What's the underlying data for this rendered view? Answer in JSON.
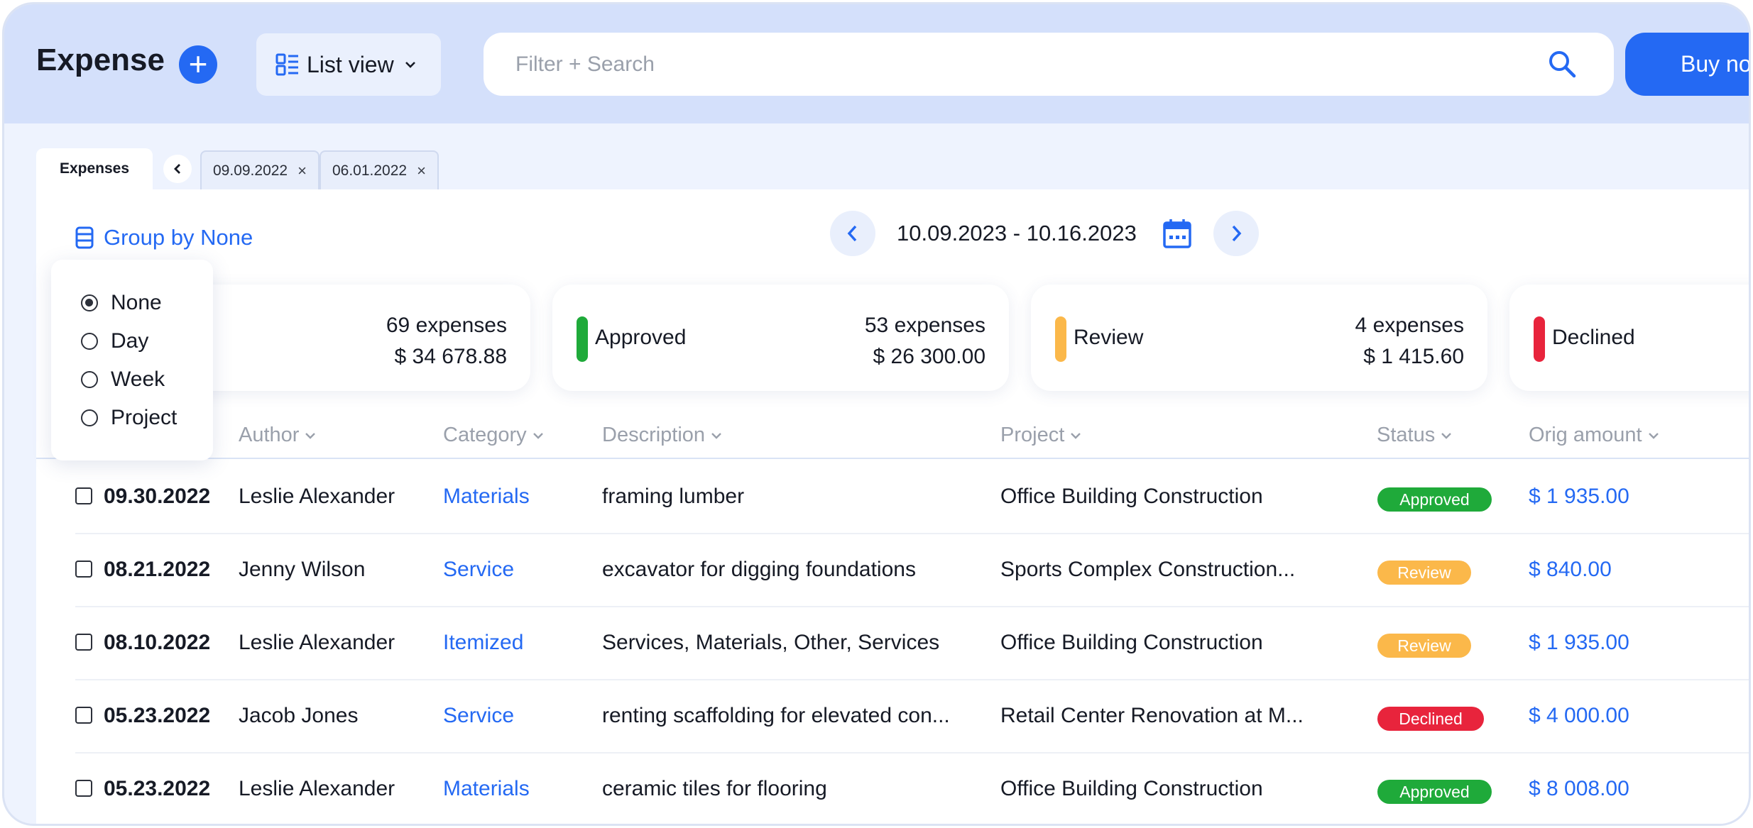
{
  "header": {
    "title": "Expense",
    "add_icon": "plus-circle-icon",
    "view_label": "List view",
    "search_placeholder": "Filter + Search",
    "buy_label": "Buy no"
  },
  "tabs": {
    "main": "Expenses",
    "chips": [
      {
        "label": "09.09.2022"
      },
      {
        "label": "06.01.2022"
      }
    ]
  },
  "toolbar": {
    "group_by_label": "Group by None",
    "date_range": "10.09.2023 - 10.16.2023"
  },
  "group_options": [
    {
      "label": "None",
      "selected": true
    },
    {
      "label": "Day",
      "selected": false
    },
    {
      "label": "Week",
      "selected": false
    },
    {
      "label": "Project",
      "selected": false
    }
  ],
  "summary_cards": [
    {
      "name": "",
      "count": "69 expenses",
      "amount": "$ 34 678.88",
      "color": ""
    },
    {
      "name": "Approved",
      "count": "53 expenses",
      "amount": "$ 26 300.00",
      "color": "#1faa3a"
    },
    {
      "name": "Review",
      "count": "4 expenses",
      "amount": "$ 1 415.60",
      "color": "#fbb84a"
    },
    {
      "name": "Declined",
      "count": "",
      "amount": "",
      "color": "#e8243c"
    }
  ],
  "columns": [
    "Author",
    "Category",
    "Description",
    "Project",
    "Status",
    "Orig amount"
  ],
  "rows": [
    {
      "date": "09.30.2022",
      "author": "Leslie Alexander",
      "category": "Materials",
      "description": "framing lumber",
      "project": "Office Building Construction",
      "status": "Approved",
      "amount": "$ 1 935.00"
    },
    {
      "date": "08.21.2022",
      "author": "Jenny Wilson",
      "category": "Service",
      "description": "excavator for digging foundations",
      "project": "Sports Complex Construction...",
      "status": "Review",
      "amount": "$ 840.00"
    },
    {
      "date": "08.10.2022",
      "author": "Leslie Alexander",
      "category": "Itemized",
      "description": "Services, Materials, Other, Services",
      "project": "Office Building Construction",
      "status": "Review",
      "amount": "$ 1 935.00"
    },
    {
      "date": "05.23.2022",
      "author": "Jacob Jones",
      "category": "Service",
      "description": "renting scaffolding for elevated con...",
      "project": "Retail Center Renovation at M...",
      "status": "Declined",
      "amount": "$ 4 000.00"
    },
    {
      "date": "05.23.2022",
      "author": "Leslie Alexander",
      "category": "Materials",
      "description": "ceramic tiles for flooring",
      "project": "Office Building Construction",
      "status": "Approved",
      "amount": "$ 8 008.00"
    }
  ],
  "status_colors": {
    "Approved": "#1faa3a",
    "Review": "#fbb84a",
    "Declined": "#e8243c"
  },
  "accent_color": "#2469f3"
}
